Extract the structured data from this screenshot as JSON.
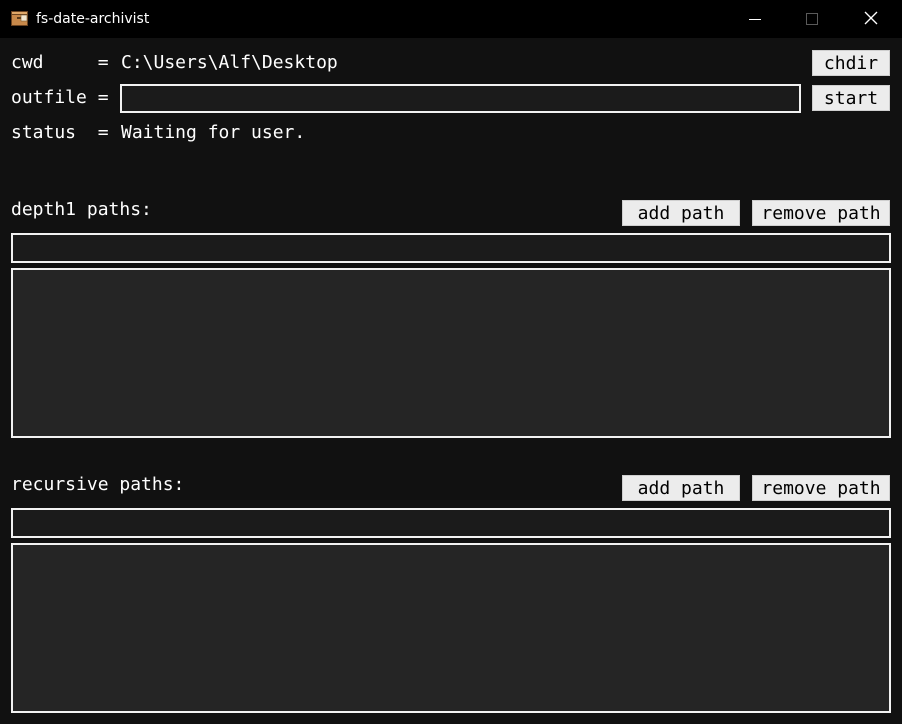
{
  "window": {
    "title": "fs-date-archivist",
    "icons": {
      "app": "archive-box-icon",
      "minimize": "minimize-icon",
      "maximize": "maximize-icon",
      "close": "close-icon"
    }
  },
  "header": {
    "cwd_key": "cwd     =",
    "cwd_value": "C:\\Users\\Alf\\Desktop",
    "outfile_key": "outfile =",
    "outfile_value": "",
    "status_key": "status  =",
    "status_value": "Waiting for user.",
    "chdir_label": "chdir",
    "start_label": "start"
  },
  "depth1": {
    "heading": "depth1 paths:",
    "add_label": "add path",
    "remove_label": "remove path",
    "entry_value": "",
    "items": []
  },
  "recursive": {
    "heading": "recursive paths:",
    "add_label": "add path",
    "remove_label": "remove path",
    "entry_value": "",
    "items": []
  },
  "colors": {
    "window_bg": "#111111",
    "titlebar_bg": "#000000",
    "button_bg": "#ececec",
    "field_border": "#f2f2f2",
    "listbox_bg": "#252525"
  }
}
